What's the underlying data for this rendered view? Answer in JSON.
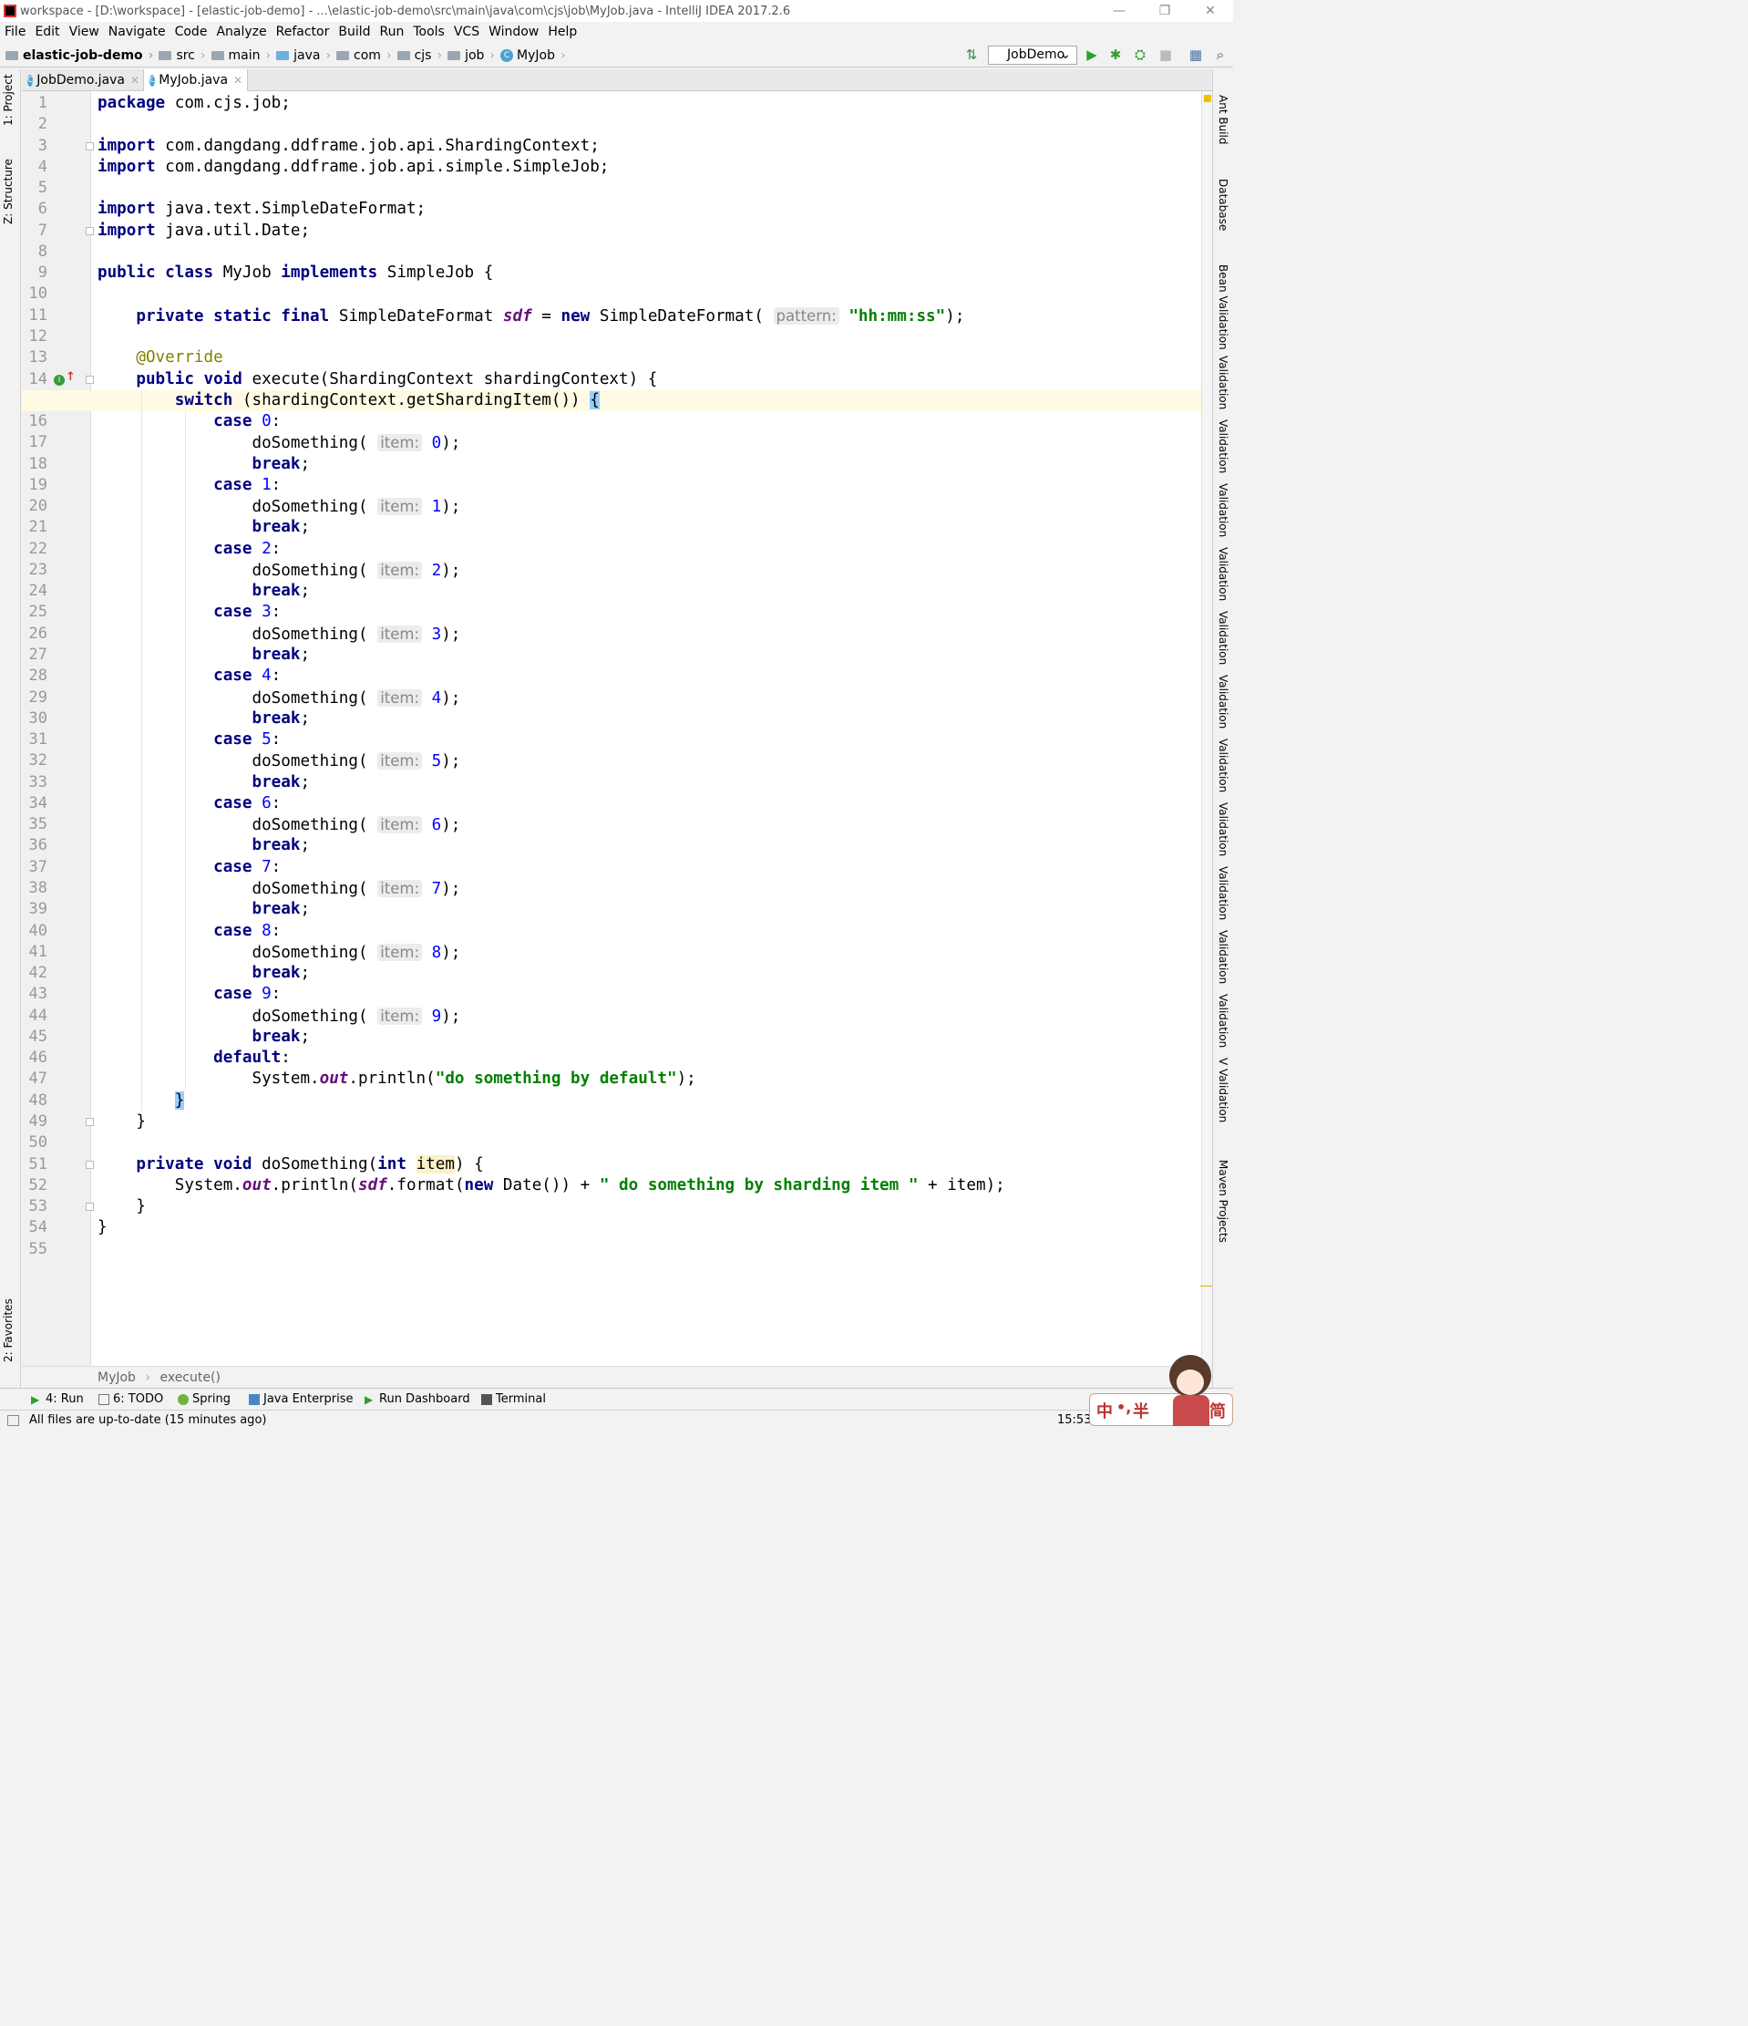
{
  "window": {
    "title": "workspace - [D:\\workspace] - [elastic-job-demo] - ...\\elastic-job-demo\\src\\main\\java\\com\\cjs\\job\\MyJob.java - IntelliJ IDEA 2017.2.6",
    "minimize": "—",
    "restore": "❐",
    "close": "✕"
  },
  "menu": [
    "File",
    "Edit",
    "View",
    "Navigate",
    "Code",
    "Analyze",
    "Refactor",
    "Build",
    "Run",
    "Tools",
    "VCS",
    "Window",
    "Help"
  ],
  "breadcrumbs": [
    "elastic-job-demo",
    "src",
    "main",
    "java",
    "com",
    "cjs",
    "job",
    "MyJob"
  ],
  "run_config": "JobDemo",
  "left_tabs": [
    "1: Project",
    "Z: Structure",
    "2: Favorites"
  ],
  "right_tabs": [
    "Ant Build",
    "Database",
    "Bean Validation",
    "Validation",
    "Validation",
    "Validation",
    "Validation",
    "Validation",
    "Validation",
    "Validation",
    "Validation",
    "Validation",
    "Validation",
    "Validation",
    "V Validation",
    "Maven Projects"
  ],
  "editor_tabs": [
    {
      "label": "JobDemo.java",
      "active": false
    },
    {
      "label": "MyJob.java",
      "active": true
    }
  ],
  "code_lines": [
    "package com.cjs.job;",
    "",
    "import com.dangdang.ddframe.job.api.ShardingContext;",
    "import com.dangdang.ddframe.job.api.simple.SimpleJob;",
    "",
    "import java.text.SimpleDateFormat;",
    "import java.util.Date;",
    "",
    "public class MyJob implements SimpleJob {",
    "",
    "    private static final SimpleDateFormat sdf = new SimpleDateFormat( pattern: \"hh:mm:ss\");",
    "",
    "    @Override",
    "    public void execute(ShardingContext shardingContext) {",
    "        switch (shardingContext.getShardingItem()) {",
    "            case 0:",
    "                doSomething( item: 0);",
    "                break;",
    "            case 1:",
    "                doSomething( item: 1);",
    "                break;",
    "            case 2:",
    "                doSomething( item: 2);",
    "                break;",
    "            case 3:",
    "                doSomething( item: 3);",
    "                break;",
    "            case 4:",
    "                doSomething( item: 4);",
    "                break;",
    "            case 5:",
    "                doSomething( item: 5);",
    "                break;",
    "            case 6:",
    "                doSomething( item: 6);",
    "                break;",
    "            case 7:",
    "                doSomething( item: 7);",
    "                break;",
    "            case 8:",
    "                doSomething( item: 8);",
    "                break;",
    "            case 9:",
    "                doSomething( item: 9);",
    "                break;",
    "            default:",
    "                System.out.println(\"do something by default\");",
    "        }",
    "    }",
    "",
    "    private void doSomething(int item) {",
    "        System.out.println(sdf.format(new Date()) + \" do something by sharding item \" + item);",
    "    }",
    "}",
    ""
  ],
  "current_line": 15,
  "editor_breadcrumb": [
    "MyJob",
    "execute()"
  ],
  "tool_windows": [
    "4: Run",
    "6: TODO",
    "Spring",
    "Java Enterprise",
    "Run Dashboard",
    "Terminal"
  ],
  "status": {
    "message": "All files are up-to-date (15 minutes ago)",
    "time": "15:53"
  },
  "ime": {
    "chars": [
      "中",
      "•,",
      "半",
      "简"
    ]
  },
  "colors": {
    "keyword": "#000080",
    "string": "#008000",
    "number": "#0000ff",
    "annotation": "#808000",
    "static_field": "#660e7a",
    "current_line_bg": "#fffae3"
  }
}
